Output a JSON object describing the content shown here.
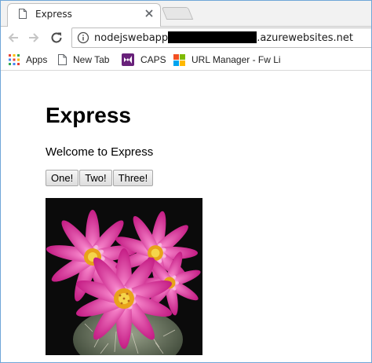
{
  "browser": {
    "tab": {
      "title": "Express"
    },
    "address": {
      "prefix": "nodejswebapp",
      "suffix": ".azurewebsites.net"
    },
    "bookmarks": [
      {
        "label": "Apps",
        "icon": "apps-grid-icon"
      },
      {
        "label": "New Tab",
        "icon": "page-icon"
      },
      {
        "label": "CAPS",
        "icon": "visual-studio-icon"
      },
      {
        "label": "URL Manager - Fw Li",
        "icon": "windows-logo-icon"
      }
    ]
  },
  "page": {
    "heading": "Express",
    "welcome": "Welcome to Express",
    "buttons": [
      "One!",
      "Two!",
      "Three!"
    ],
    "image": {
      "subject": "pink-cactus-flower"
    }
  },
  "colors": {
    "window_border": "#6fa6d8",
    "tabstrip_bg": "#f2f2f2",
    "flower_pink": "#e0359a",
    "flower_center": "#e8a21a",
    "image_bg": "#0b0b0b"
  }
}
